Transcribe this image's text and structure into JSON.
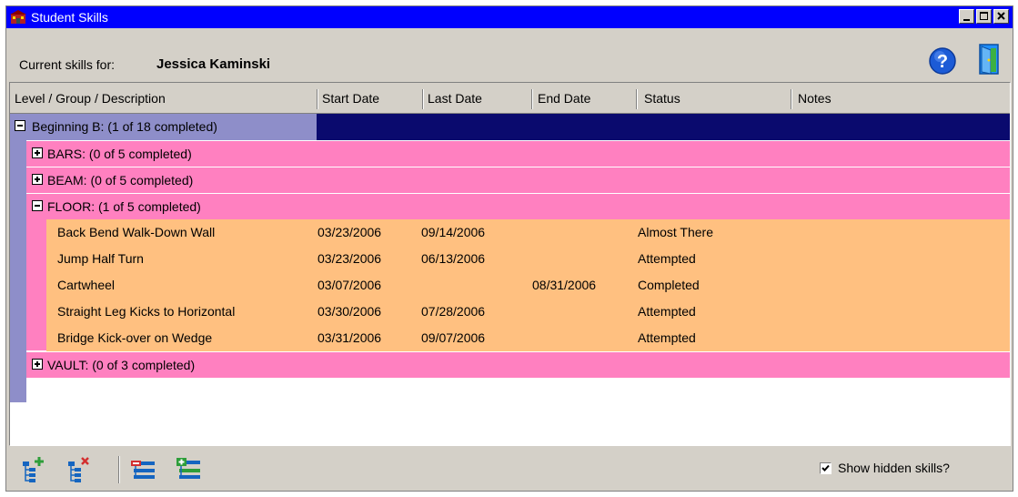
{
  "window": {
    "title": "Student Skills"
  },
  "header": {
    "current_label": "Current skills for:",
    "student_name": "Jessica Kaminski"
  },
  "columns": [
    "Level / Group / Description",
    "Start Date",
    "Last Date",
    "End Date",
    "Status",
    "Notes"
  ],
  "level": {
    "label": "Beginning B:  (1 of 18 completed)"
  },
  "groups": [
    {
      "label": "BARS:  (0 of 5 completed)",
      "expanded": false
    },
    {
      "label": "BEAM:  (0 of 5 completed)",
      "expanded": false
    },
    {
      "label": "FLOOR:  (1 of 5 completed)",
      "expanded": true
    },
    {
      "label": "VAULT:  (0 of 3 completed)",
      "expanded": false
    }
  ],
  "skills": [
    {
      "description": "Back Bend Walk-Down Wall",
      "start": "03/23/2006",
      "last": "09/14/2006",
      "end": "",
      "status": "Almost There",
      "notes": ""
    },
    {
      "description": "Jump Half Turn",
      "start": "03/23/2006",
      "last": "06/13/2006",
      "end": "",
      "status": "Attempted",
      "notes": ""
    },
    {
      "description": "Cartwheel",
      "start": "03/07/2006",
      "last": "",
      "end": "08/31/2006",
      "status": "Completed",
      "notes": ""
    },
    {
      "description": "Straight Leg Kicks to Horizontal",
      "start": "03/30/2006",
      "last": "07/28/2006",
      "end": "",
      "status": "Attempted",
      "notes": ""
    },
    {
      "description": "Bridge Kick-over on Wedge",
      "start": "03/31/2006",
      "last": "09/07/2006",
      "end": "",
      "status": "Attempted",
      "notes": ""
    }
  ],
  "footer": {
    "show_hidden_label": "Show hidden skills?",
    "show_hidden_checked": true
  },
  "colors": {
    "level": "#8e8ec9",
    "level_selected": "#0a0a6e",
    "group": "#ff80c0",
    "skill": "#ffc080",
    "titlebar": "#0000ff"
  },
  "icons": [
    "app-icon",
    "help-icon",
    "exit-door-icon",
    "add-skill-icon",
    "remove-skill-icon",
    "collapse-all-icon",
    "expand-all-icon"
  ]
}
